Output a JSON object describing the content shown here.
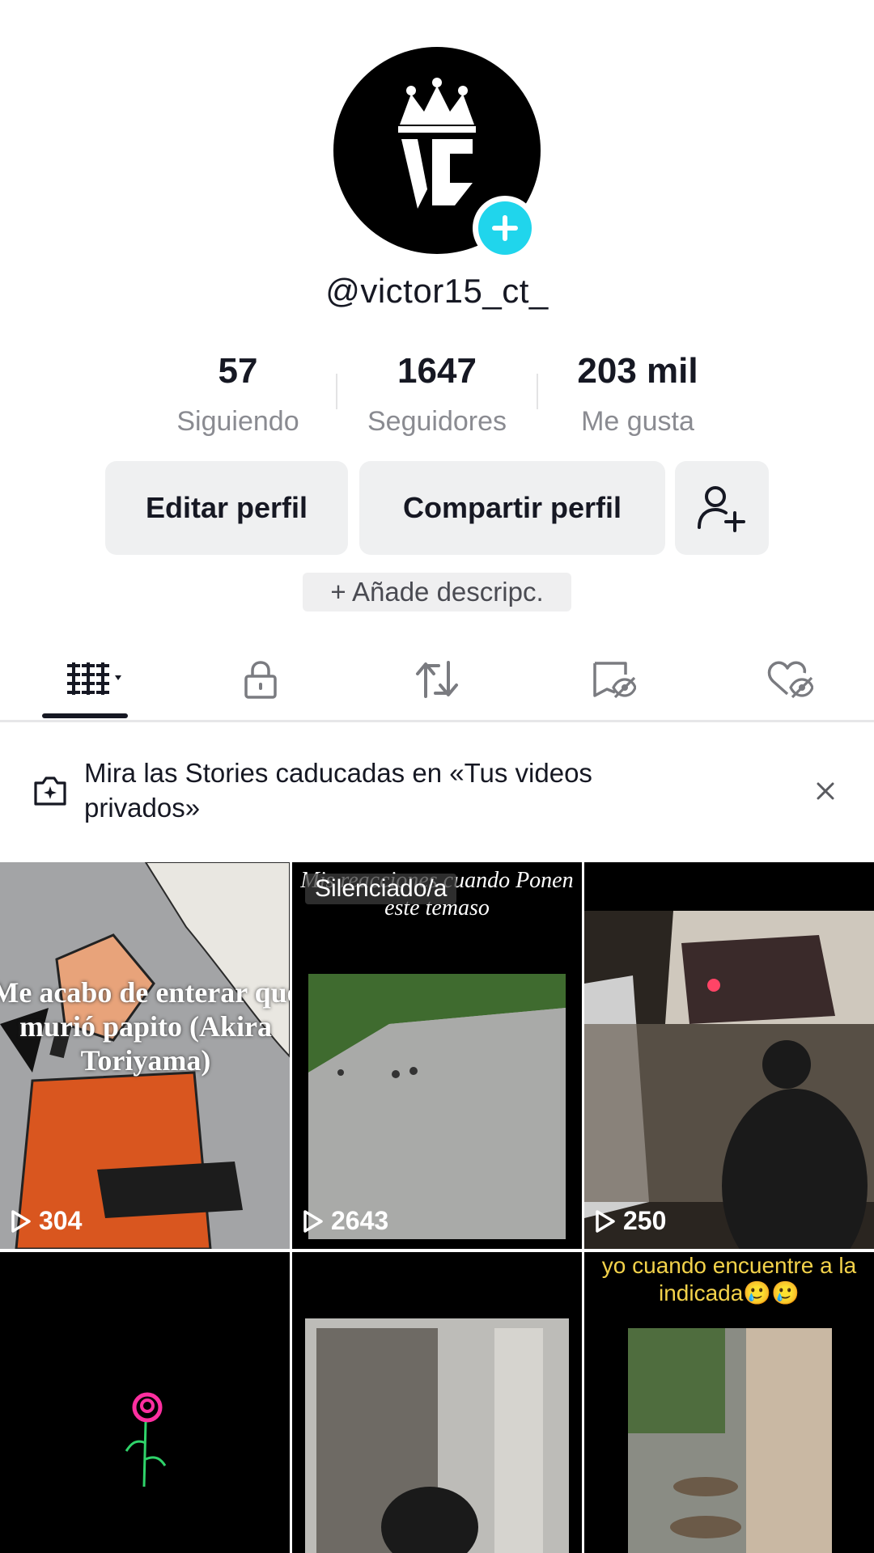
{
  "profile": {
    "username": "@victor15_ct_",
    "avatar_icon": "vc-crown-logo",
    "avatar_add_icon": "plus-icon"
  },
  "stats": [
    {
      "value": "57",
      "label": "Siguiendo"
    },
    {
      "value": "1647",
      "label": "Seguidores"
    },
    {
      "value": "203 mil",
      "label": "Me gusta"
    }
  ],
  "actions": {
    "edit_label": "Editar perfil",
    "share_label": "Compartir perfil",
    "add_friend_icon": "person-add-icon",
    "add_description_label": "+ Añade descripc."
  },
  "tabs": [
    {
      "icon": "grid-icon",
      "active": true
    },
    {
      "icon": "lock-icon"
    },
    {
      "icon": "repost-icon"
    },
    {
      "icon": "bookmark-hidden-icon"
    },
    {
      "icon": "heart-hidden-icon"
    }
  ],
  "banner": {
    "text": "Mira las Stories caducadas en «Tus videos privados»",
    "icon": "camera-story-icon",
    "close_icon": "close-icon"
  },
  "videos": [
    {
      "views": "304",
      "caption": "Me acabo de enterar que murió papito (Akira Toriyama)"
    },
    {
      "views": "2643",
      "badge": "Silenciado/a",
      "caption": "Mis reacciones cuando Ponen este temaso"
    },
    {
      "views": "250"
    },
    {},
    {},
    {
      "caption": "yo cuando encuentre a la indicada🥲🥲"
    }
  ],
  "colors": {
    "accent": "#20d5ec",
    "text_primary": "#161823",
    "text_secondary": "#8a8b91",
    "button_bg": "#eff0f1"
  }
}
